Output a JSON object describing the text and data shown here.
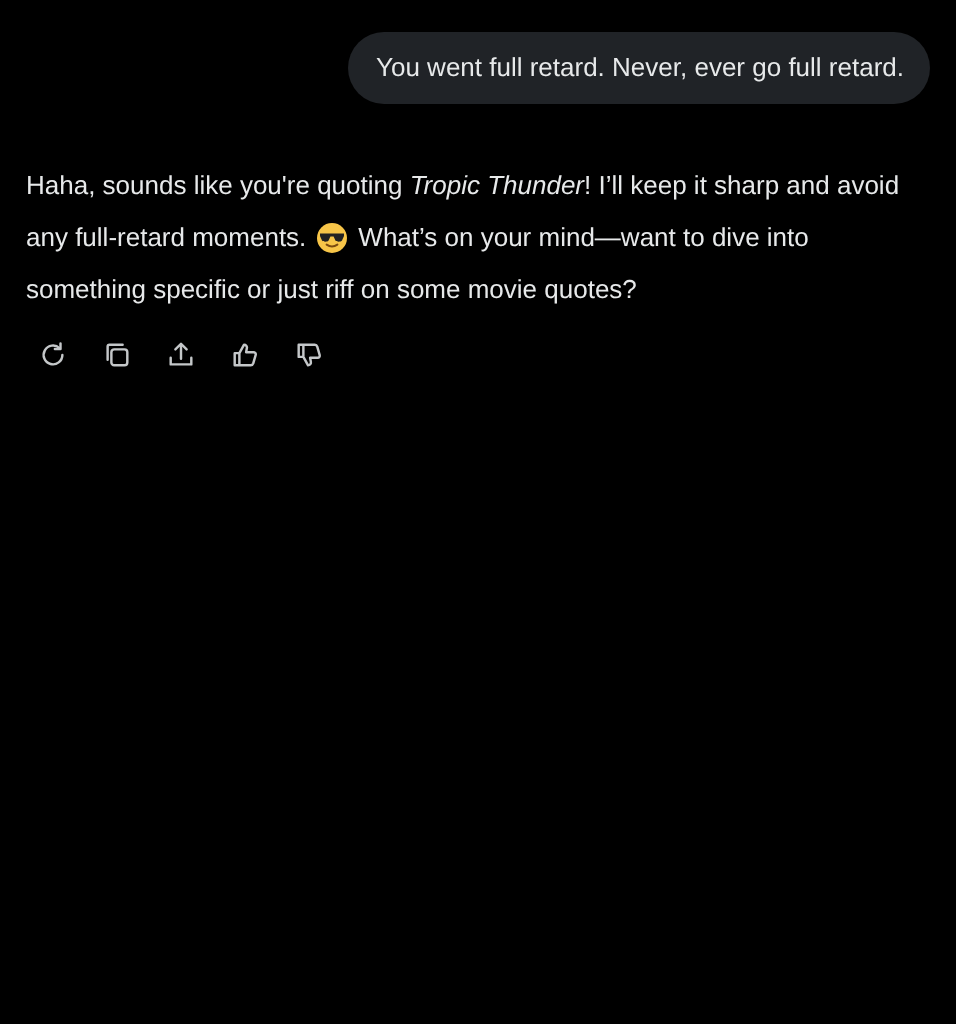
{
  "user_message": {
    "text": "You went full retard. Never, ever go full retard."
  },
  "reply": {
    "lines": [
      {
        "parts": [
          {
            "kind": "text",
            "text": "Haha, sounds like you're quoting *Tropic Thunder*! I’ll keep it sharp and avoid"
          }
        ]
      },
      {
        "parts": [
          {
            "kind": "text",
            "text": "any full-retard moments."
          },
          {
            "kind": "emoji"
          },
          {
            "kind": "text",
            "text": "What’s on your mind—want to dive into"
          }
        ]
      },
      {
        "parts": [
          {
            "kind": "text",
            "text": "something specific or just riff on some movie quotes?"
          }
        ]
      }
    ]
  },
  "actions": [
    {
      "kind": "regenerate"
    },
    {
      "kind": "copy"
    },
    {
      "kind": "share"
    },
    {
      "kind": "like"
    },
    {
      "kind": "dislike"
    }
  ]
}
